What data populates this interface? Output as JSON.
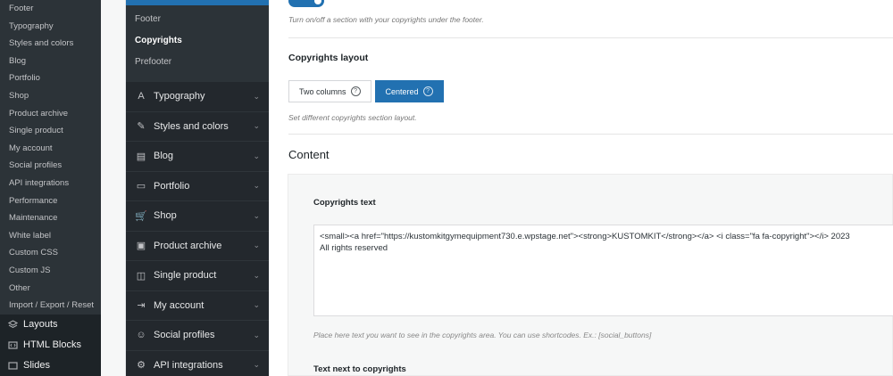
{
  "wp_sidebar": {
    "sub_items": [
      "Footer",
      "Typography",
      "Styles and colors",
      "Blog",
      "Portfolio",
      "Shop",
      "Product archive",
      "Single product",
      "My account",
      "Social profiles",
      "API integrations",
      "Performance",
      "Maintenance",
      "White label",
      "Custom CSS",
      "Custom JS",
      "Other",
      "Import / Export / Reset"
    ],
    "main_items": [
      {
        "label": "Layouts",
        "icon": "layouts-icon"
      },
      {
        "label": "HTML Blocks",
        "icon": "html-blocks-icon"
      },
      {
        "label": "Slides",
        "icon": "slides-icon"
      }
    ]
  },
  "panel": {
    "sub_items": [
      {
        "label": "Footer",
        "active": false
      },
      {
        "label": "Copyrights",
        "active": true
      },
      {
        "label": "Prefooter",
        "active": false
      }
    ],
    "items": [
      {
        "label": "Typography",
        "icon": "typography-icon",
        "glyph": "A"
      },
      {
        "label": "Styles and colors",
        "icon": "brush-icon",
        "glyph": "✎"
      },
      {
        "label": "Blog",
        "icon": "blog-icon",
        "glyph": "▤"
      },
      {
        "label": "Portfolio",
        "icon": "briefcase-icon",
        "glyph": "▭"
      },
      {
        "label": "Shop",
        "icon": "cart-icon",
        "glyph": "🛒"
      },
      {
        "label": "Product archive",
        "icon": "archive-icon",
        "glyph": "▣"
      },
      {
        "label": "Single product",
        "icon": "bag-icon",
        "glyph": "◫"
      },
      {
        "label": "My account",
        "icon": "account-icon",
        "glyph": "⇥"
      },
      {
        "label": "Social profiles",
        "icon": "social-icon",
        "glyph": "☺"
      },
      {
        "label": "API integrations",
        "icon": "gear-icon",
        "glyph": "⚙"
      }
    ]
  },
  "main": {
    "toggle_desc": "Turn on/off a section with your copyrights under the footer.",
    "layout": {
      "title": "Copyrights layout",
      "options": [
        "Two columns",
        "Centered"
      ],
      "selected": "Centered",
      "help_glyph": "?",
      "desc": "Set different copyrights section layout."
    },
    "content_heading": "Content",
    "copyrights_text": {
      "label": "Copyrights text",
      "value_line1": "<small><a href=\"https://kustomkitgymequipment730.e.wpstage.net\"><strong>KUSTOMKIT</strong></a> <i class=\"fa fa-copyright\"></i>  2023",
      "value_line2": "All rights reserved",
      "desc": "Place here text you want to see in the copyrights area. You can use shortcodes. Ex.: [social_buttons]"
    },
    "next_label": "Text next to copyrights"
  },
  "colors": {
    "accent": "#2271b1",
    "wp_sidebar_bg": "#1d2327",
    "panel_bg": "#23282d"
  }
}
